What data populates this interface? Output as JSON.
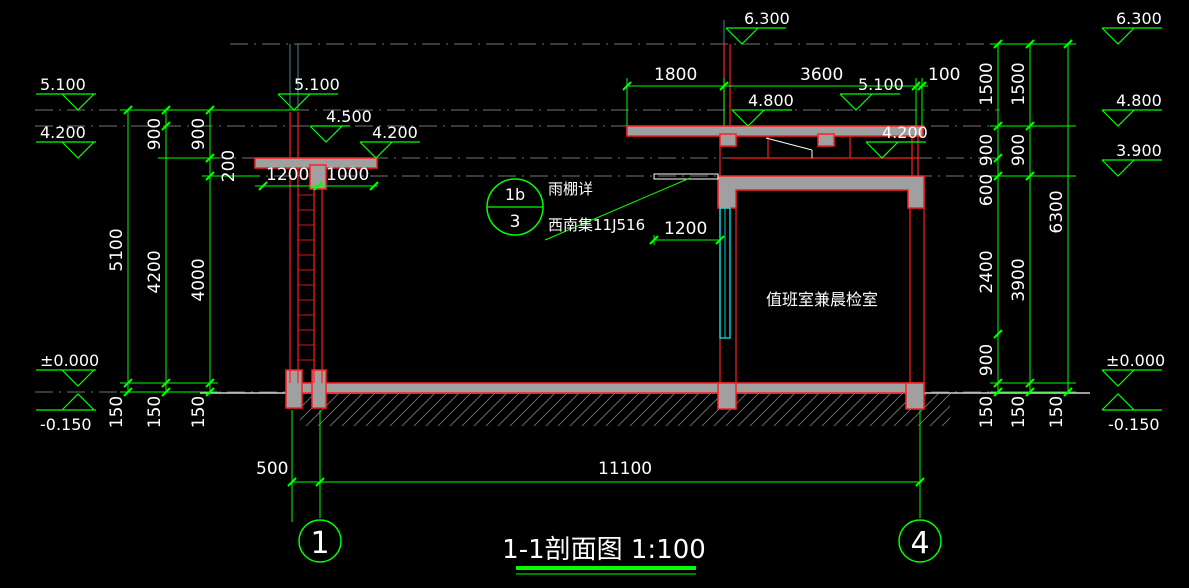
{
  "title": "1-1剖面图 1:100",
  "room_label": "值班室兼晨检室",
  "detail_ref": {
    "top": "1b",
    "bottom": "3",
    "line1": "雨棚详",
    "line2": "西南集11J516"
  },
  "axes": {
    "left": "1",
    "right": "4"
  },
  "left_elevations": {
    "e5100": "5.100",
    "e4200": "4.200",
    "e0": "±0.000",
    "em150": "-0.150"
  },
  "left_dims": {
    "d5100": "5100",
    "d4200": "4200",
    "d4000": "4000",
    "d900a": "900",
    "d900b": "900",
    "d200": "200",
    "d150a": "150",
    "d150b": "150",
    "d150c": "150"
  },
  "canopy_left": {
    "e5100": "5.100",
    "e4500": "4.500",
    "e4200": "4.200",
    "d1200": "1200",
    "d1000": "1000"
  },
  "right_building": {
    "e6300": "6.300",
    "e4800": "4.800",
    "e5100": "5.100",
    "e4200": "4.200",
    "d1800": "1800",
    "d3600": "3600",
    "d100": "100",
    "d1200": "1200"
  },
  "right_elevations": {
    "e6300": "6.300",
    "e4800": "4.800",
    "e3900": "3.900",
    "e0": "±0.000",
    "em150": "-0.150"
  },
  "right_dims": {
    "d1500a": "1500",
    "d1500b": "1500",
    "d900a": "900",
    "d900b": "900",
    "d600": "600",
    "d2400": "2400",
    "d3900": "3900",
    "d900c": "900",
    "d6300": "6300",
    "d150a": "150",
    "d150b": "150",
    "d150c": "150"
  },
  "bottom_dims": {
    "d500": "500",
    "d11100": "11100"
  },
  "colors": {
    "dim": "#00ff00",
    "ext": "#56a6b8",
    "wall": "#ff2020",
    "slab": "#a0a0a0",
    "glass": "#00ffff",
    "ground": "#888888"
  }
}
